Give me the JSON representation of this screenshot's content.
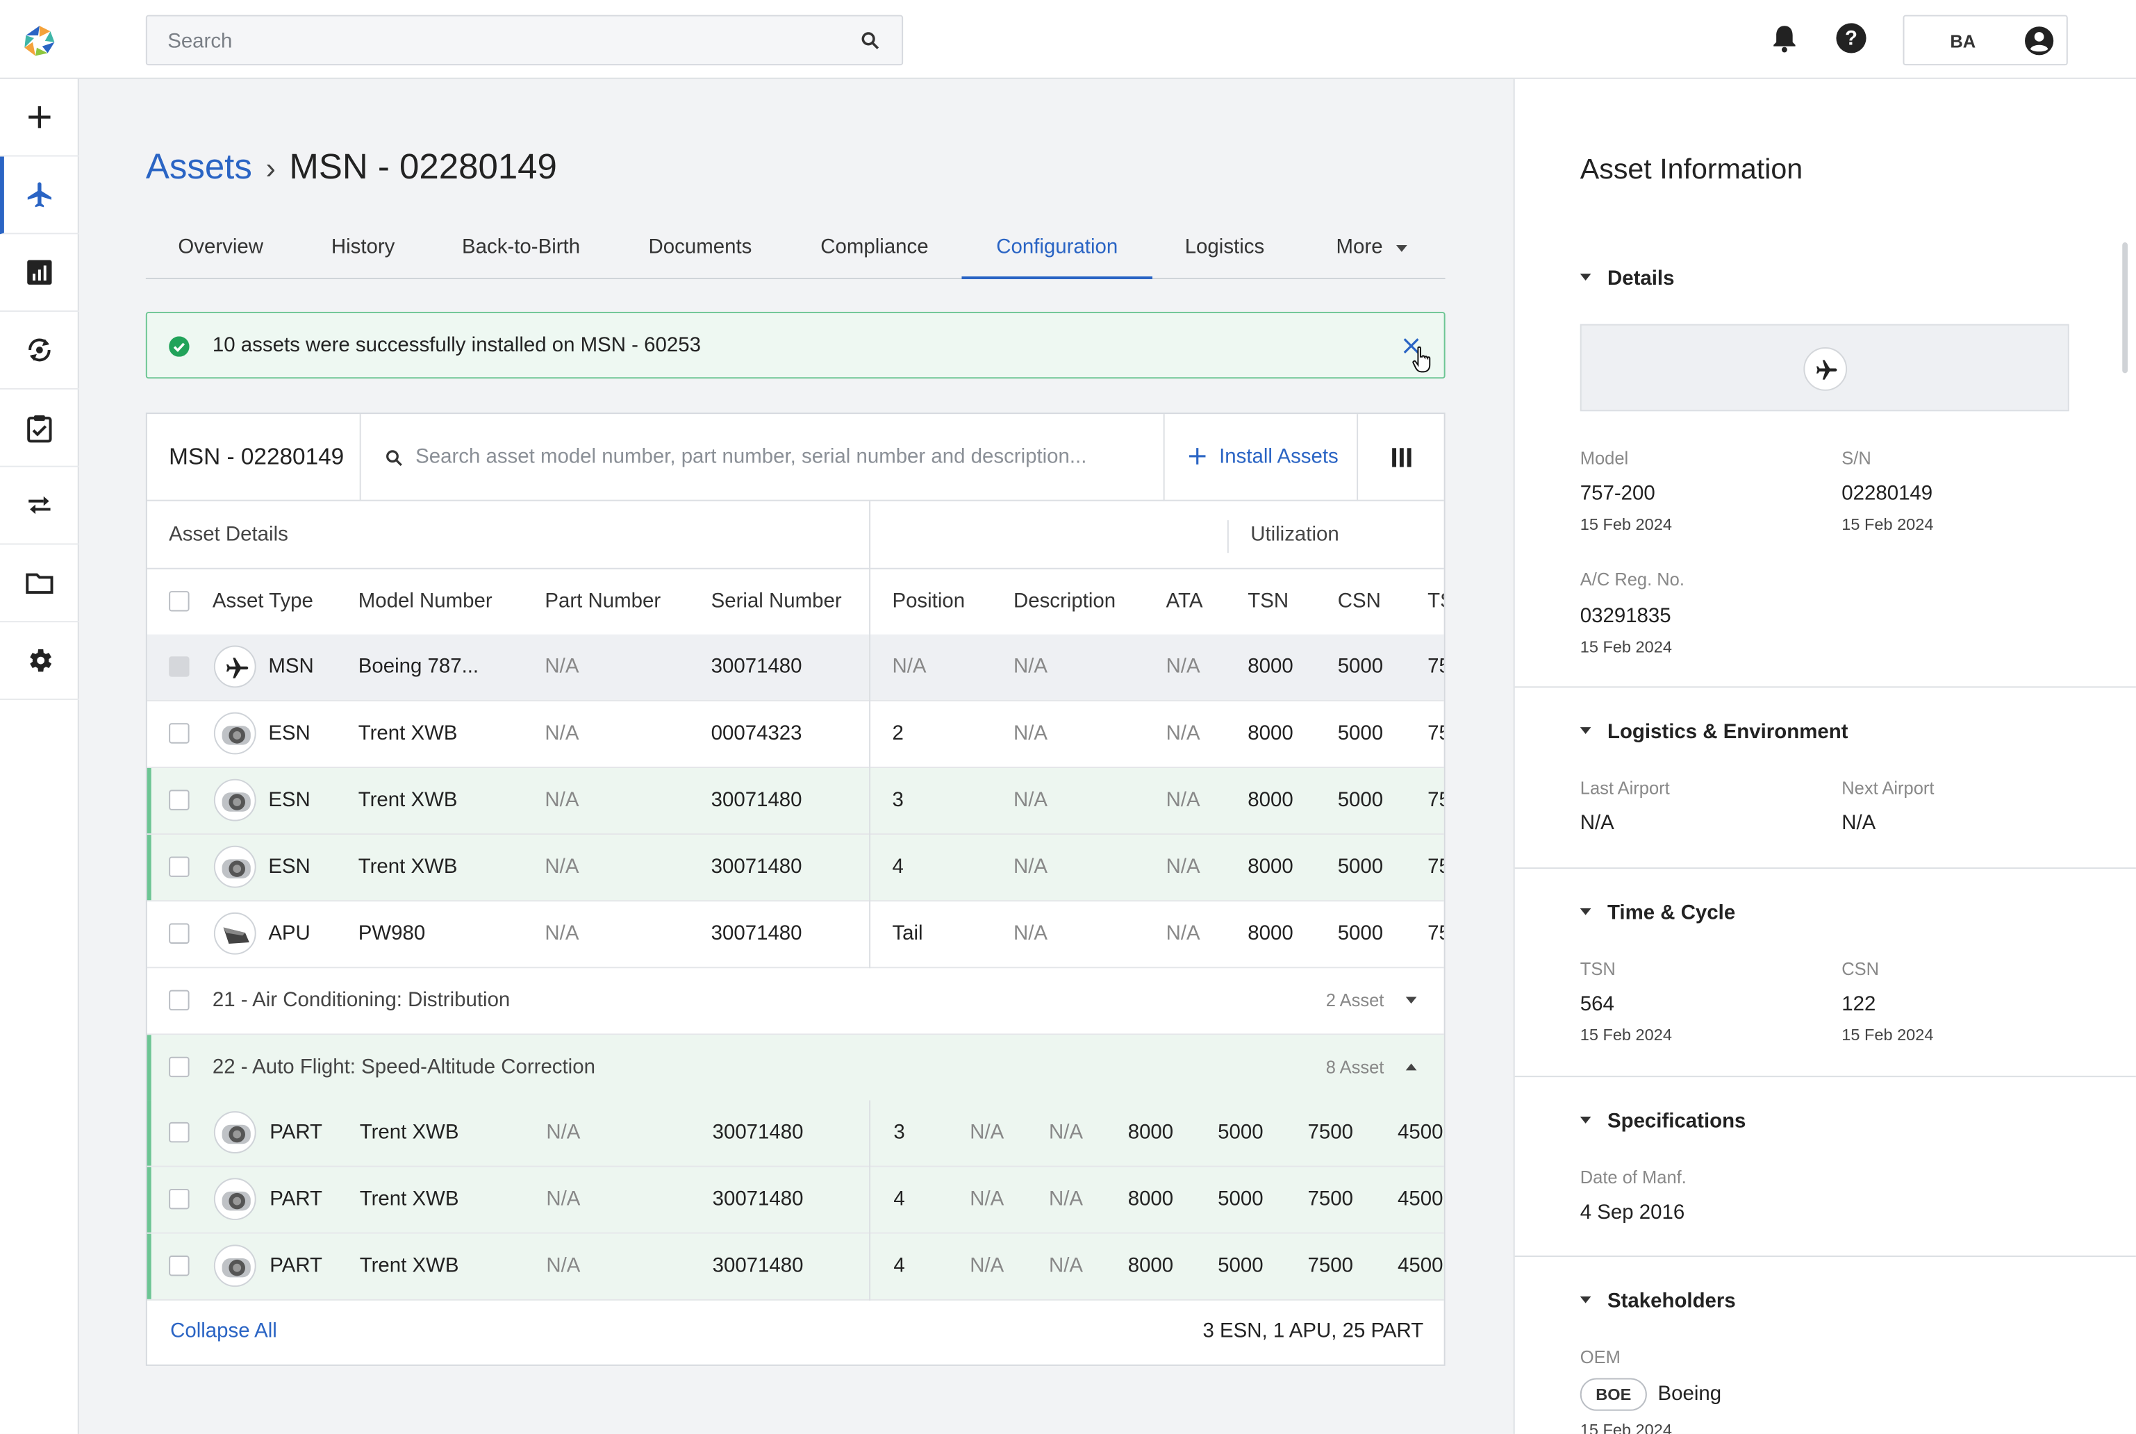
{
  "header": {
    "search_placeholder": "Search",
    "user_initials": "BA",
    "icons": [
      "search-icon",
      "bell-icon",
      "help-icon",
      "user-avatar-icon"
    ]
  },
  "sidebar": {
    "items": [
      {
        "name": "add",
        "icon": "plus-icon",
        "active": false
      },
      {
        "name": "assets",
        "icon": "airplane-icon",
        "active": true
      },
      {
        "name": "reports",
        "icon": "chart-icon",
        "active": false
      },
      {
        "name": "sync",
        "icon": "sync-icon",
        "active": false
      },
      {
        "name": "tasks",
        "icon": "clipboard-check-icon",
        "active": false
      },
      {
        "name": "transfer",
        "icon": "transfer-icon",
        "active": false
      },
      {
        "name": "files",
        "icon": "folder-icon",
        "active": false
      },
      {
        "name": "settings",
        "icon": "gear-icon",
        "active": false
      }
    ]
  },
  "breadcrumb": {
    "root": "Assets",
    "separator": "›",
    "current": "MSN - 02280149"
  },
  "tabs": [
    {
      "label": "Overview"
    },
    {
      "label": "History"
    },
    {
      "label": "Back-to-Birth"
    },
    {
      "label": "Documents"
    },
    {
      "label": "Compliance"
    },
    {
      "label": "Configuration",
      "active": true
    },
    {
      "label": "Logistics"
    },
    {
      "label": "More"
    }
  ],
  "toast": {
    "message": "10 assets were successfully installed on MSN - 60253"
  },
  "table": {
    "msn_label": "MSN - 02280149",
    "search_placeholder": "Search asset model number, part number, serial number and description...",
    "install_label": "Install Assets",
    "group_headers": {
      "details": "Asset Details",
      "utilization": "Utilization"
    },
    "columns": [
      "Asset Type",
      "Model Number",
      "Part Number",
      "Serial Number",
      "Position",
      "Description",
      "ATA",
      "TSN",
      "CSN",
      "TS"
    ],
    "rows": [
      {
        "icon": "airplane-icon",
        "type": "MSN",
        "model": "Boeing 787...",
        "part": "N/A",
        "serial": "30071480",
        "position": "N/A",
        "desc": "N/A",
        "ata": "N/A",
        "tsn": "8000",
        "csn": "5000",
        "ts": "75"
      },
      {
        "icon": "engine-icon",
        "type": "ESN",
        "model": "Trent XWB",
        "part": "N/A",
        "serial": "00074323",
        "position": "2",
        "desc": "N/A",
        "ata": "N/A",
        "tsn": "8000",
        "csn": "5000",
        "ts": "75"
      },
      {
        "icon": "engine-icon",
        "type": "ESN",
        "model": "Trent XWB",
        "part": "N/A",
        "serial": "30071480",
        "position": "3",
        "desc": "N/A",
        "ata": "N/A",
        "tsn": "8000",
        "csn": "5000",
        "ts": "75"
      },
      {
        "icon": "engine-icon",
        "type": "ESN",
        "model": "Trent XWB",
        "part": "N/A",
        "serial": "30071480",
        "position": "4",
        "desc": "N/A",
        "ata": "N/A",
        "tsn": "8000",
        "csn": "5000",
        "ts": "75"
      },
      {
        "icon": "apu-icon",
        "type": "APU",
        "model": "PW980",
        "part": "N/A",
        "serial": "30071480",
        "position": "Tail",
        "desc": "N/A",
        "ata": "N/A",
        "tsn": "8000",
        "csn": "5000",
        "ts": "75"
      }
    ],
    "groups": [
      {
        "label": "21 - Air Conditioning: Distribution",
        "count": "2 Asset",
        "expanded": false
      },
      {
        "label": "22 - Auto Flight: Speed-Altitude Correction",
        "count": "8 Asset",
        "expanded": true
      }
    ],
    "part_rows": [
      {
        "type": "PART",
        "model": "Trent XWB",
        "part": "N/A",
        "serial": "30071480",
        "position": "3",
        "desc": "N/A",
        "ata": "N/A",
        "tsn": "8000",
        "csn": "5000",
        "tso": "7500",
        "cso": "4500"
      },
      {
        "type": "PART",
        "model": "Trent XWB",
        "part": "N/A",
        "serial": "30071480",
        "position": "4",
        "desc": "N/A",
        "ata": "N/A",
        "tsn": "8000",
        "csn": "5000",
        "tso": "7500",
        "cso": "4500"
      },
      {
        "type": "PART",
        "model": "Trent XWB",
        "part": "N/A",
        "serial": "30071480",
        "position": "4",
        "desc": "N/A",
        "ata": "N/A",
        "tsn": "8000",
        "csn": "5000",
        "tso": "7500",
        "cso": "4500"
      }
    ],
    "collapse_label": "Collapse All",
    "summary": "3 ESN, 1 APU, 25 PART"
  },
  "panel": {
    "title": "Asset Information",
    "details": {
      "heading": "Details",
      "model_label": "Model",
      "model": "757-200",
      "model_date": "15 Feb 2024",
      "sn_label": "S/N",
      "sn": "02280149",
      "sn_date": "15 Feb 2024",
      "reg_label": "A/C Reg. No.",
      "reg": "03291835",
      "reg_date": "15 Feb 2024"
    },
    "logistics": {
      "heading": "Logistics & Environment",
      "last_label": "Last Airport",
      "last": "N/A",
      "next_label": "Next Airport",
      "next": "N/A"
    },
    "time": {
      "heading": "Time & Cycle",
      "tsn_label": "TSN",
      "tsn": "564",
      "tsn_date": "15 Feb 2024",
      "csn_label": "CSN",
      "csn": "122",
      "csn_date": "15 Feb 2024"
    },
    "specs": {
      "heading": "Specifications",
      "manf_label": "Date of Manf.",
      "manf": "4 Sep 2016"
    },
    "stakeholders": {
      "heading": "Stakeholders",
      "oem_label": "OEM",
      "oem_badge": "BOE",
      "oem": "Boeing",
      "oem_date": "15 Feb 2024"
    }
  },
  "colors": {
    "accent": "#2a64c4",
    "success": "#6cc593",
    "success_bg": "#edf6f0"
  }
}
